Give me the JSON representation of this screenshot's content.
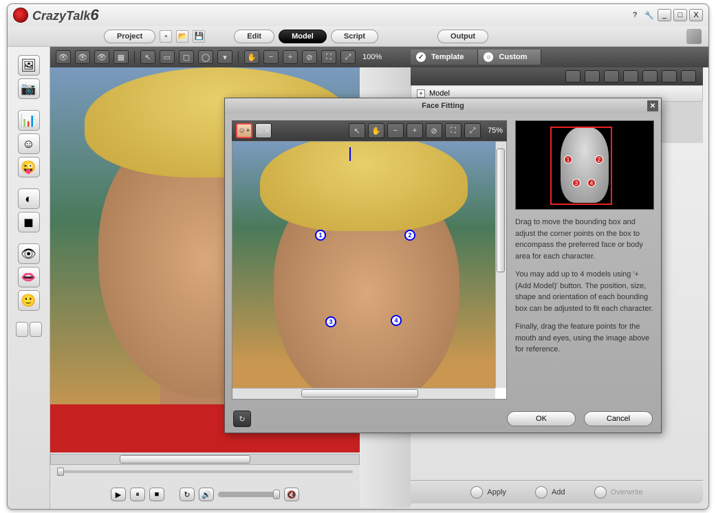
{
  "app": {
    "name": "CrazyTalk",
    "version": "6"
  },
  "titlebar": {
    "help": "?",
    "min": "_",
    "max": "□",
    "close": "X"
  },
  "menu": {
    "project": "Project",
    "edit": "Edit",
    "model": "Model",
    "script": "Script",
    "output": "Output"
  },
  "canvas": {
    "zoom": "100%"
  },
  "right": {
    "tab_template": "Template",
    "tab_custom": "Custom",
    "model_label": "Model",
    "apply": "Apply",
    "add": "Add",
    "overwrite": "Overwrite"
  },
  "dialog": {
    "title": "Face Fitting",
    "zoom": "75%",
    "markers": {
      "m1": "1",
      "m2": "2",
      "m3": "3",
      "m4": "4"
    },
    "help1": "Drag to move the bounding box and adjust the corner points on the box to encompass the preferred face or body area for each character.",
    "help2": "You may add up to 4 models using '+ (Add Model)' button. The position, size, shape and orientation of each bounding box can be adjusted to fit each character.",
    "help3": "Finally, drag the feature points for the mouth and eyes, using the image above for reference.",
    "ok": "OK",
    "cancel": "Cancel"
  }
}
